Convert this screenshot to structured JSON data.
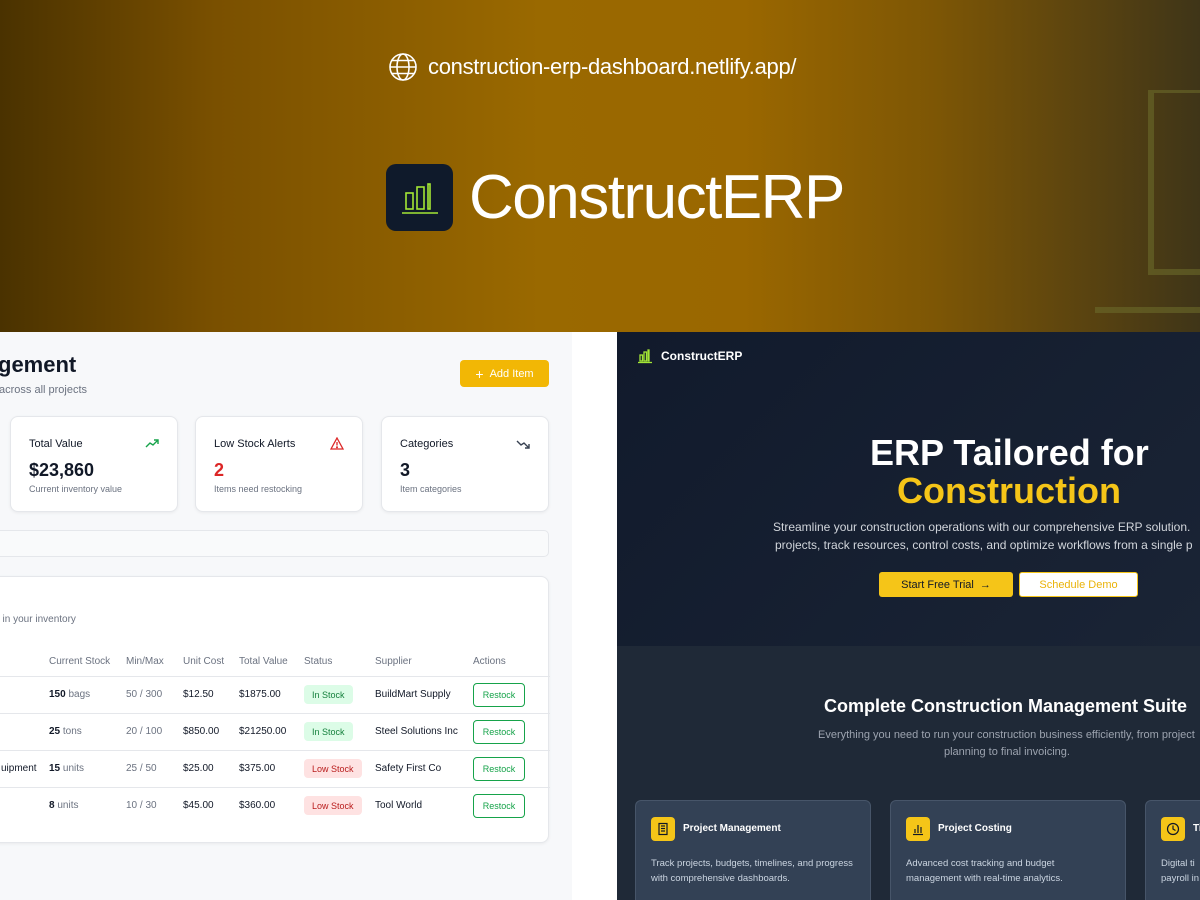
{
  "hero": {
    "url": "construction-erp-dashboard.netlify.app/",
    "brand_name": "ConstructERP"
  },
  "inventory": {
    "title": "gement",
    "subtitle": "across all projects",
    "add_button": "Add Item",
    "stats": [
      {
        "label": "Total Value",
        "value": "$23,860",
        "desc": "Current inventory value",
        "icon": "trending-up-icon"
      },
      {
        "label": "Low Stock Alerts",
        "value": "2",
        "desc": "Items need restocking",
        "icon": "alert-triangle-icon"
      },
      {
        "label": "Categories",
        "value": "3",
        "desc": "Item categories",
        "icon": "trending-down-icon"
      }
    ],
    "table_subtitle": "t in your inventory",
    "columns": [
      "Current Stock",
      "Min/Max",
      "Unit Cost",
      "Total Value",
      "Status",
      "Supplier",
      "Actions"
    ],
    "rows": [
      {
        "name": "",
        "qty": "150",
        "unit": "bags",
        "minmax": "50 / 300",
        "unit_cost": "$12.50",
        "total": "$1875.00",
        "status": "In Stock",
        "supplier": "BuildMart Supply",
        "action": "Restock"
      },
      {
        "name": "",
        "qty": "25",
        "unit": "tons",
        "minmax": "20 / 100",
        "unit_cost": "$850.00",
        "total": "$21250.00",
        "status": "In Stock",
        "supplier": "Steel Solutions Inc",
        "action": "Restock"
      },
      {
        "name": "uipment",
        "qty": "15",
        "unit": "units",
        "minmax": "25 / 50",
        "unit_cost": "$25.00",
        "total": "$375.00",
        "status": "Low Stock",
        "supplier": "Safety First Co",
        "action": "Restock"
      },
      {
        "name": "",
        "qty": "8",
        "unit": "units",
        "minmax": "10 / 30",
        "unit_cost": "$45.00",
        "total": "$360.00",
        "status": "Low Stock",
        "supplier": "Tool World",
        "action": "Restock"
      }
    ]
  },
  "landing": {
    "nav_brand": "ConstructERP",
    "headline_1": "ERP Tailored for",
    "headline_2": "Construction",
    "lead_1": "Streamline your construction operations with our comprehensive ERP solution.",
    "lead_2": "projects, track resources, control costs, and optimize workflows from a single p",
    "cta_primary": "Start Free Trial",
    "cta_secondary": "Schedule Demo",
    "section_title": "Complete Construction Management Suite",
    "section_sub_1": "Everything you need to run your construction business efficiently, from project",
    "section_sub_2": "planning to final invoicing.",
    "features": [
      {
        "title": "Project Management",
        "d1": "Track projects, budgets, timelines, and progress",
        "d2": "with comprehensive dashboards.",
        "icon": "building-icon"
      },
      {
        "title": "Project Costing",
        "d1": "Advanced cost tracking and budget",
        "d2": "management with real-time analytics.",
        "icon": "bar-chart-icon"
      },
      {
        "title": "Ti",
        "d1": "Digital ti",
        "d2": "payroll in",
        "icon": "clock-icon"
      }
    ]
  },
  "colors": {
    "accent": "#f5c518",
    "navy": "#111a2c",
    "success": "#16a34a",
    "danger": "#dc2626"
  }
}
